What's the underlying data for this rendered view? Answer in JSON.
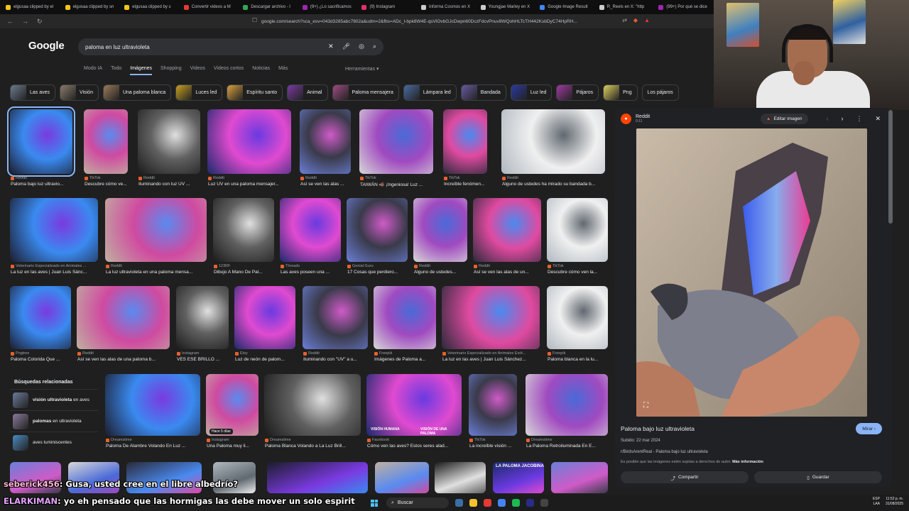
{
  "browser": {
    "tabs": [
      {
        "label": "elgusaa clipped by el",
        "color": "#f5c518"
      },
      {
        "label": "elgusaa clipped by sn",
        "color": "#f5c518"
      },
      {
        "label": "elgusaa clipped by s",
        "color": "#f5c518"
      },
      {
        "label": "Convertir videos a M",
        "color": "#e53935"
      },
      {
        "label": "Descargar archivo - l",
        "color": "#34a853"
      },
      {
        "label": "(9+) ¿Lo sacrificamos",
        "color": "#9c27b0"
      },
      {
        "label": "(9) Instagram",
        "color": "#e1306c"
      },
      {
        "label": "Informa Cosmos en X",
        "color": "#cccccc"
      },
      {
        "label": "Youngjae Marley en X",
        "color": "#cccccc"
      },
      {
        "label": "Google Image Result",
        "color": "#4285f4"
      },
      {
        "label": "R_Reels en X: \"http",
        "color": "#cccccc"
      },
      {
        "label": "(99+) Por qué se dice",
        "color": "#9c27b0"
      }
    ],
    "url": "google.com/search?sca_esv=043d3285abc7802a&udm=2&fbs=ADc_l-bpk8W4E-qsVlOvbGJcDwpn60DczFdcvPnuv8WQohHLTcTH442KsbDyC74HpRH..."
  },
  "google": {
    "logo": "Google",
    "query": "paloma en luz ultravioleta",
    "nav_tabs": [
      {
        "label": "Modo IA",
        "active": false
      },
      {
        "label": "Todo",
        "active": false
      },
      {
        "label": "Imágenes",
        "active": true
      },
      {
        "label": "Shopping",
        "active": false
      },
      {
        "label": "Videos",
        "active": false
      },
      {
        "label": "Videos cortos",
        "active": false
      },
      {
        "label": "Noticias",
        "active": false
      },
      {
        "label": "Más",
        "active": false
      }
    ],
    "tools_label": "Herramientas",
    "chips": [
      {
        "label": "Las aves",
        "color": "#6b7b8c"
      },
      {
        "label": "Visión",
        "color": "#8c7b6b"
      },
      {
        "label": "Una paloma blanca",
        "color": "#9a7a5a"
      },
      {
        "label": "Luces led",
        "color": "#c8a020"
      },
      {
        "label": "Espíritu santo",
        "color": "#d9a040"
      },
      {
        "label": "Animal",
        "color": "#7a3aa0"
      },
      {
        "label": "Paloma mensajera",
        "color": "#a04a80"
      },
      {
        "label": "Lámpara led",
        "color": "#4a6aa0"
      },
      {
        "label": "Bandada",
        "color": "#6a5aa0"
      },
      {
        "label": "Luz led",
        "color": "#2a3aa0"
      },
      {
        "label": "Pájaros",
        "color": "#a03aa0"
      },
      {
        "label": "Png",
        "color": "#e0d060"
      },
      {
        "label": "Los pájaros",
        "color": ""
      }
    ]
  },
  "results": {
    "row1": [
      {
        "source": "Reddit",
        "caption": "Paloma bajo luz ultravio..."
      },
      {
        "source": "TikTok",
        "caption": "Descubre cómo ve..."
      },
      {
        "source": "Reddit",
        "caption": "Iluminando con luz UV ..."
      },
      {
        "source": "Reddit",
        "caption": "Luz UV en una paloma mensajer..."
      },
      {
        "source": "Reddit",
        "caption": "Así se ven las alas ..."
      },
      {
        "source": "TikTok",
        "caption": "TAIWÁN 🐗 ¡Ingeniosa! Luz ..."
      },
      {
        "source": "TikTok",
        "caption": "Increíble fenómen..."
      },
      {
        "source": "Reddit",
        "caption": "Alguno de ustedes ha mirado su bandada b..."
      }
    ],
    "row2": [
      {
        "source": "Veterinario Especializado en Animales ...",
        "caption": "La luz en las aves | Juan Luis Sánc..."
      },
      {
        "source": "Reddit",
        "caption": "La luz ultravioleta en una paloma mensa..."
      },
      {
        "source": "123RF",
        "caption": "Dibujo A Mano De Pal..."
      },
      {
        "source": "Threads",
        "caption": "Las aves poseen una ..."
      },
      {
        "source": "Genial Guru",
        "caption": "17 Cosas que perdiero..."
      },
      {
        "source": "Reddit",
        "caption": "Alguno de ustedes..."
      },
      {
        "source": "Reddit",
        "caption": "Así se ven las alas de un..."
      },
      {
        "source": "TikTok",
        "caption": "Descubre cómo ven la..."
      }
    ],
    "row3": [
      {
        "source": "Pngtree",
        "caption": "Paloma Colorida Que ..."
      },
      {
        "source": "Reddit",
        "caption": "Así se ven las alas de una paloma b..."
      },
      {
        "source": "Instagram",
        "caption": "VES ESE BRILLO ..."
      },
      {
        "source": "Etsy",
        "caption": "Luz de neón de palom..."
      },
      {
        "source": "Reddit",
        "caption": "Iluminando con \"UV\" a u..."
      },
      {
        "source": "Freepik",
        "caption": "Imágenes de Paloma a..."
      },
      {
        "source": "Veterinario Especializado en Animales Exót...",
        "caption": "La luz en las aves | Juan Luis Sánchez..."
      },
      {
        "source": "Freepik",
        "caption": "Paloma blanca en la lu..."
      }
    ],
    "row4": [
      {
        "source": "Dreamstime",
        "caption": "Paloma De Alambre Volando En Luz ..."
      },
      {
        "source": "Instagram",
        "caption": "Una Paloma muy li..."
      },
      {
        "source": "Dreamstime",
        "caption": "Paloma Blanca Volando a La Luz Brill..."
      },
      {
        "source": "Facebook",
        "caption": "Cómo ven las aves? Estos seres alad..."
      },
      {
        "source": "TikTok",
        "caption": "La increíble visión ..."
      },
      {
        "source": "Dreamstime",
        "caption": "La Paloma Retroiluminada En E..."
      }
    ],
    "overlay_human": "VISIÓN HUMANA",
    "overlay_bird": "VISIÓN DE UNA PALOMA",
    "hace_label": "Hace 5 días",
    "jacobina": "LA PALOMA JACOBINA"
  },
  "related": {
    "title": "Búsquedas relacionadas",
    "items": [
      {
        "bold": "visión ultravioleta",
        "rest": " en aves"
      },
      {
        "bold": "palomas",
        "rest": " en ultravioleta"
      },
      {
        "bold": "",
        "rest": "aves luminiscentes"
      }
    ]
  },
  "panel": {
    "site": "Reddit",
    "site_sub": "0:11",
    "edit_label": "Editar imagen",
    "title": "Paloma bajo luz ultravioleta",
    "visit_label": "Mirar",
    "date": "Subido: 22 mar 2024",
    "from": "r/BirdsArentReal - Paloma bajo luz ultravioleta",
    "copyright": "Es posible que las imágenes estén sujetas a derechos de autor.",
    "copyright_link": "Más información",
    "share_label": "Compartir",
    "save_label": "Guardar"
  },
  "chat": {
    "messages": [
      {
        "user": "seberick456",
        "text": ": Gusa, usted cree en el libre albedrío?"
      },
      {
        "user": "ELARKIMAN",
        "text": ": yo eh pensado que las hormigas las debe mover un solo espiritu"
      }
    ]
  },
  "taskbar": {
    "search_label": "Buscar",
    "tray_lang": "ESP",
    "tray_region": "LAA",
    "tray_time": "11:52 p. m.",
    "tray_date": "31/08/2025"
  }
}
